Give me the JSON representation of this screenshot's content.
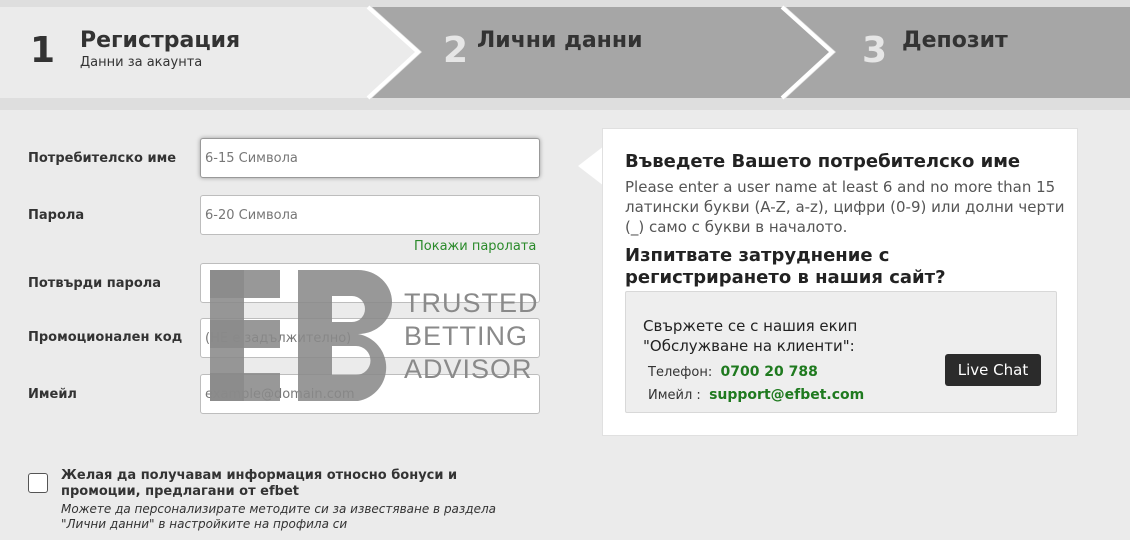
{
  "stepper": {
    "steps": [
      {
        "number": "1",
        "title": "Регистрация",
        "subtitle": "Данни за акаунта"
      },
      {
        "number": "2",
        "title": "Лични данни"
      },
      {
        "number": "3",
        "title": "Депозит"
      }
    ]
  },
  "form": {
    "username": {
      "label": "Потребителско име",
      "placeholder": "6-15 Символа"
    },
    "password": {
      "label": "Парола",
      "placeholder": "6-20 Символа"
    },
    "show_password": "Покажи паролата",
    "confirm_password": {
      "label": "Потвърди парола",
      "placeholder": ""
    },
    "promo_code": {
      "label": "Промоционален код",
      "placeholder": "(НЕ е задължително)"
    },
    "email": {
      "label": "Имейл",
      "placeholder": "example@domain.com"
    }
  },
  "info_panel": {
    "heading": "Въведете Вашето потребителско име",
    "description": "Please enter a user name at least 6 and no more than 15 латински букви (A-Z, a-z), цифри (0-9) или долни черти (_) само с букви в началото.",
    "help_heading_line1": "Изпитвате затруднение с",
    "help_heading_line2": "регистрирането в нашия сайт?",
    "support": {
      "text_line1": "Свържете се с нашия екип",
      "text_line2": "\"Обслужване на клиенти\":",
      "phone_label": "Телефон:",
      "phone_value": "0700 20 788",
      "email_label": "Имейл :",
      "email_value": "support@efbet.com",
      "live_chat_label": "Live Chat"
    }
  },
  "consent": {
    "label": "Желая да получавам информация относно бонуси и промоции, предлагани от efbet",
    "note": "Можете да персонализирате методите си за известяване в раздела \"Лични данни\" в настройките на профила си"
  },
  "watermark": {
    "line1": "TRUSTED",
    "line2": "BETTING",
    "line3": "ADVISOR"
  },
  "colors": {
    "background": "#ebebeb",
    "step_active": "#ebebeb",
    "step_inactive": "#a6a6a6",
    "link_green": "#2a8a2a",
    "button_dark": "#2b2b2b"
  }
}
